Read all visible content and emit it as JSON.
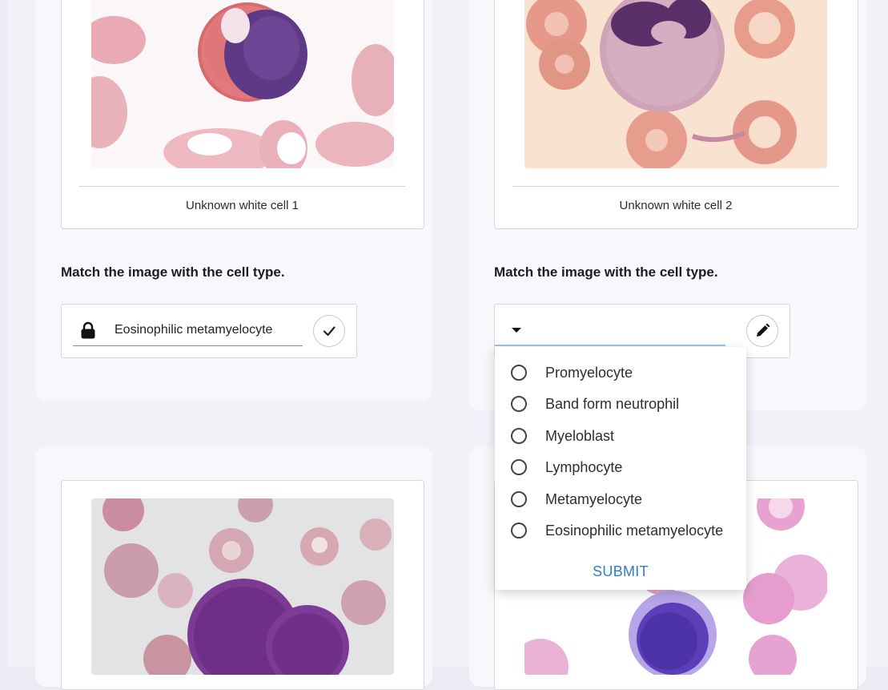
{
  "cells": [
    {
      "caption": "Unknown white cell 1"
    },
    {
      "caption": "Unknown white cell 2"
    }
  ],
  "questions": [
    {
      "prompt": "Match the image with the cell type.",
      "answer": "Eosinophilic metamyelocyte"
    },
    {
      "prompt": "Match the image with the cell type.",
      "answer": ""
    }
  ],
  "dropdown": {
    "options": [
      "Promyelocyte",
      "Band form neutrophil",
      "Myeloblast",
      "Lymphocyte",
      "Metamyelocyte",
      "Eosinophilic metamyelocyte"
    ],
    "submit_label": "SUBMIT"
  },
  "colors": {
    "accent": "#2f7fc2",
    "page_bg": "#f3f1f8",
    "card_border": "#d8d6dd"
  },
  "icons": [
    "lock-icon",
    "check-icon",
    "caret-down-icon",
    "pencil-icon"
  ]
}
